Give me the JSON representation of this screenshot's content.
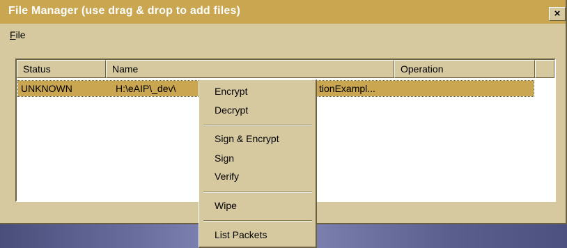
{
  "window": {
    "title": "File Manager (use drag & drop to add files)",
    "close_label": "×"
  },
  "menubar": {
    "file_accel": "F",
    "file_rest": "ile"
  },
  "list": {
    "columns": [
      "Status",
      "Name",
      "Operation"
    ],
    "rows": [
      {
        "status": "UNKNOWN",
        "name_left": "H:\\eAIP\\_dev\\",
        "name_right": "tionExampl..."
      }
    ]
  },
  "context_menu": {
    "items": [
      "Encrypt",
      "Decrypt",
      "Sign & Encrypt",
      "Sign",
      "Verify",
      "Wipe",
      "List Packets"
    ]
  },
  "colors": {
    "titlebar": "#c9a64f",
    "window_face": "#d6c9a0",
    "selection": "#c9a64f"
  },
  "icons": [
    "close-icon"
  ]
}
